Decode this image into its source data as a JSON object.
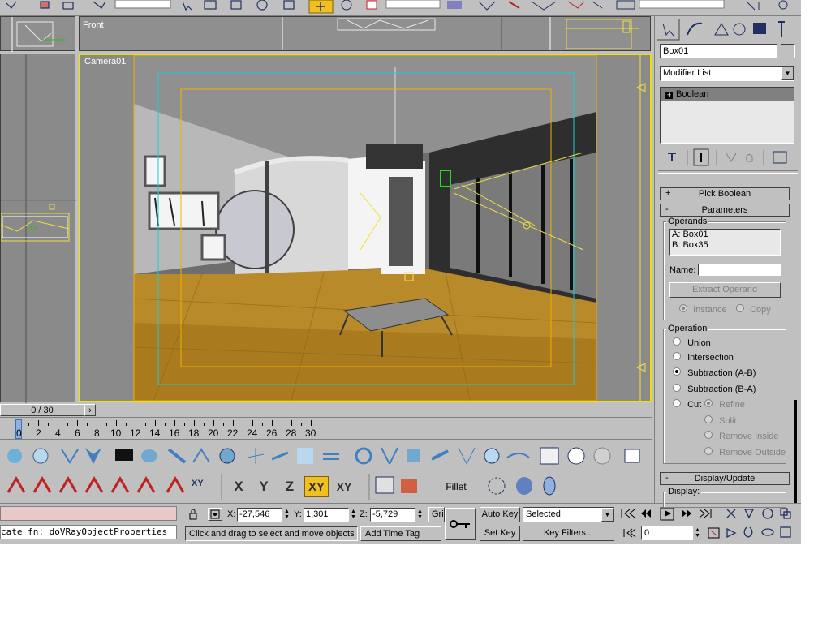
{
  "viewports": {
    "front_label": "Front",
    "camera_label": "Camera01"
  },
  "time_slider": {
    "frame_label": "0 / 30",
    "next_arrow": "›"
  },
  "track": {
    "ticks": [
      "0",
      "2",
      "4",
      "6",
      "8",
      "10",
      "12",
      "14",
      "16",
      "18",
      "20",
      "22",
      "24",
      "26",
      "28",
      "30"
    ]
  },
  "command_panel": {
    "object_name": "Box01",
    "modifier_list": "Modifier List",
    "stack_item": "Boolean",
    "pick_boolean": "Pick Boolean",
    "parameters": "Parameters",
    "operands_label": "Operands",
    "operand_a": "A: Box01",
    "operand_b": "B: Box35",
    "name_label": "Name:",
    "extract_operand": "Extract Operand",
    "instance": "Instance",
    "copy": "Copy",
    "operation_label": "Operation",
    "union": "Union",
    "intersection": "Intersection",
    "subtraction_ab": "Subtraction (A-B)",
    "subtraction_ba": "Subtraction (B-A)",
    "cut": "Cut",
    "refine": "Refine",
    "split": "Split",
    "remove_inside": "Remove Inside",
    "remove_outside": "Remove Outside",
    "display_update": "Display/Update",
    "display_label": "Display:",
    "plus": "+",
    "minus": "-"
  },
  "toolbar2": {
    "axis_x": "X",
    "axis_y": "Y",
    "axis_z": "Z",
    "axis_xy": "XY",
    "axis_xy2": "XY",
    "fillet": "Fillet",
    "snap_xy": "XY"
  },
  "status": {
    "x_label": "X:",
    "x_value": "-27,546",
    "y_label": "Y:",
    "y_value": "1,301",
    "z_label": "Z:",
    "z_value": "-5,729",
    "grid_label": "Gri",
    "maxscript": "cate fn: doVRayObjectProperties",
    "prompt": "Click and drag to select and move objects",
    "add_time_tag": "Add Time Tag",
    "auto_key": "Auto Key",
    "set_key": "Set Key",
    "selected": "Selected",
    "key_filters": "Key Filters...",
    "frame_value": "0"
  }
}
